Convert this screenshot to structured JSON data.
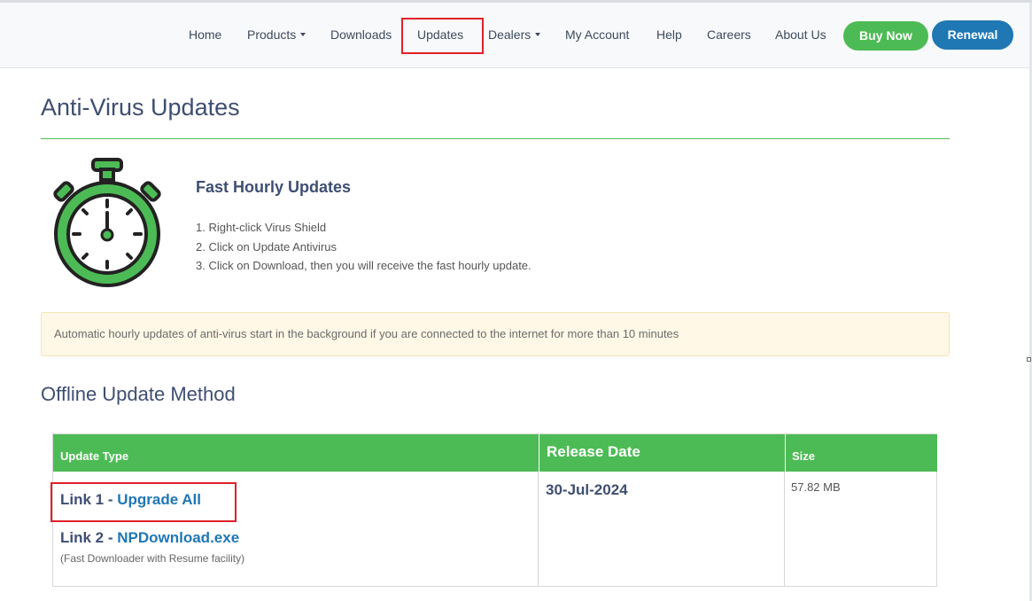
{
  "nav": {
    "items": [
      {
        "label": "Home",
        "dropdown": false
      },
      {
        "label": "Products",
        "dropdown": true
      },
      {
        "label": "Downloads",
        "dropdown": false
      },
      {
        "label": "Updates",
        "dropdown": false,
        "highlighted": true
      },
      {
        "label": "Dealers",
        "dropdown": true
      },
      {
        "label": "My Account",
        "dropdown": false
      },
      {
        "label": "Help",
        "dropdown": false
      },
      {
        "label": "Careers",
        "dropdown": false
      },
      {
        "label": "About Us",
        "dropdown": false
      }
    ],
    "buy_now": "Buy Now",
    "renewal": "Renewal"
  },
  "page": {
    "title": "Anti-Virus Updates"
  },
  "feature": {
    "icon": "stopwatch-icon",
    "title": "Fast Hourly Updates",
    "steps": [
      "1. Right-click Virus Shield",
      "2. Click on Update Antivirus",
      "3. Click on Download, then you will receive the fast hourly update."
    ]
  },
  "alert": {
    "text": "Automatic hourly updates of anti-virus start in the background if you are connected to the internet for more than 10 minutes"
  },
  "offline": {
    "title": "Offline Update Method",
    "headers": {
      "type": "Update Type",
      "date": "Release Date",
      "size": "Size"
    },
    "link1": {
      "prefix": "Link 1 - ",
      "label": "Upgrade All"
    },
    "link2": {
      "prefix": "Link 2 - ",
      "label": "NPDownload.exe"
    },
    "note": "(Fast Downloader with Resume facility)",
    "release_date": "30-Jul-2024",
    "size": "57.82 MB"
  },
  "colors": {
    "accent_green": "#4dbb55",
    "accent_blue": "#1f77b4",
    "heading": "#3e4e72",
    "highlight_red": "#e0202a"
  }
}
